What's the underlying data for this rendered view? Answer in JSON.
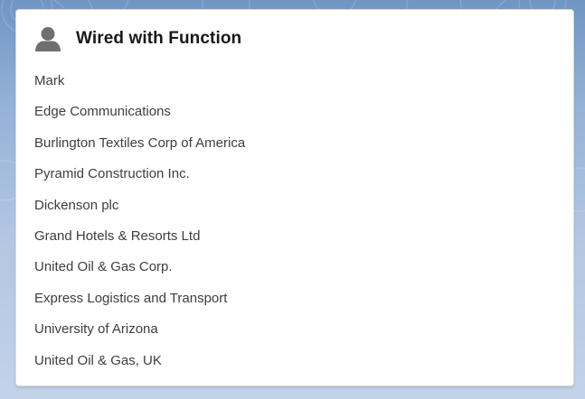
{
  "card": {
    "title": "Wired with Function",
    "icon": "user-icon"
  },
  "accounts": [
    "Mark",
    "Edge Communications",
    "Burlington Textiles Corp of America",
    "Pyramid Construction Inc.",
    "Dickenson plc",
    "Grand Hotels & Resorts Ltd",
    "United Oil & Gas Corp.",
    "Express Logistics and Transport",
    "University of Arizona",
    "United Oil & Gas, UK"
  ],
  "colors": {
    "background_top": "#6f95c4",
    "background_bottom": "#c2d2e9",
    "card": "#ffffff",
    "icon": "#6f6f6f",
    "title_text": "#181818",
    "item_text": "#3e3e3c"
  }
}
